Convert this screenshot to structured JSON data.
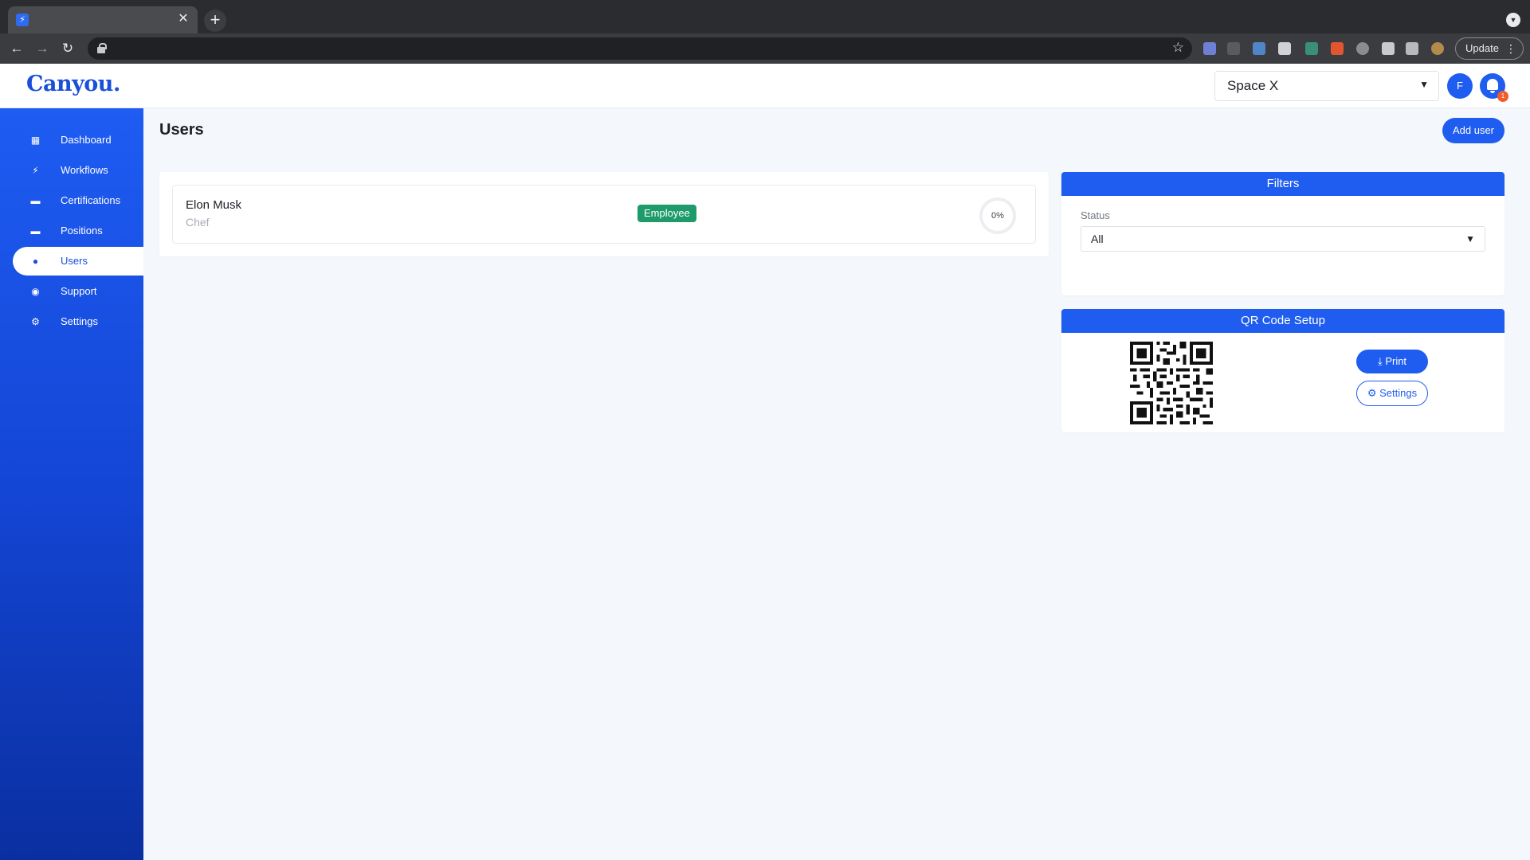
{
  "browser": {
    "tab_favicon_icon": "bolt-icon",
    "close_glyph": "✕",
    "new_tab_glyph": "+",
    "update_label": "Update"
  },
  "header": {
    "logo_text": "Canyou.",
    "company": "Space X",
    "avatar_initial": "F",
    "notification_count": "1"
  },
  "sidebar": {
    "items": [
      {
        "label": "Dashboard",
        "icon": "dashboard-icon",
        "glyph": "▦"
      },
      {
        "label": "Workflows",
        "icon": "bolt-icon",
        "glyph": "⚡"
      },
      {
        "label": "Certifications",
        "icon": "briefcase-icon",
        "glyph": "▬"
      },
      {
        "label": "Positions",
        "icon": "briefcase-icon",
        "glyph": "▬"
      },
      {
        "label": "Users",
        "icon": "user-icon",
        "glyph": "●"
      },
      {
        "label": "Support",
        "icon": "chat-icon",
        "glyph": "◉"
      },
      {
        "label": "Settings",
        "icon": "gear-icon",
        "glyph": "⚙"
      }
    ],
    "active": "Users"
  },
  "main": {
    "title": "Users",
    "add_user_label": "Add user",
    "users": [
      {
        "name": "Elon Musk",
        "role": "Chef",
        "type": "Employee",
        "progress": "0%"
      }
    ]
  },
  "filters": {
    "title": "Filters",
    "status_label": "Status",
    "status_value": "All"
  },
  "qr": {
    "title": "QR Code Setup",
    "print_label": "Print",
    "settings_label": "Settings"
  },
  "colors": {
    "accent": "#1f5cf0",
    "employee_badge": "#1e9a6b",
    "notification_badge": "#f25c2a"
  }
}
